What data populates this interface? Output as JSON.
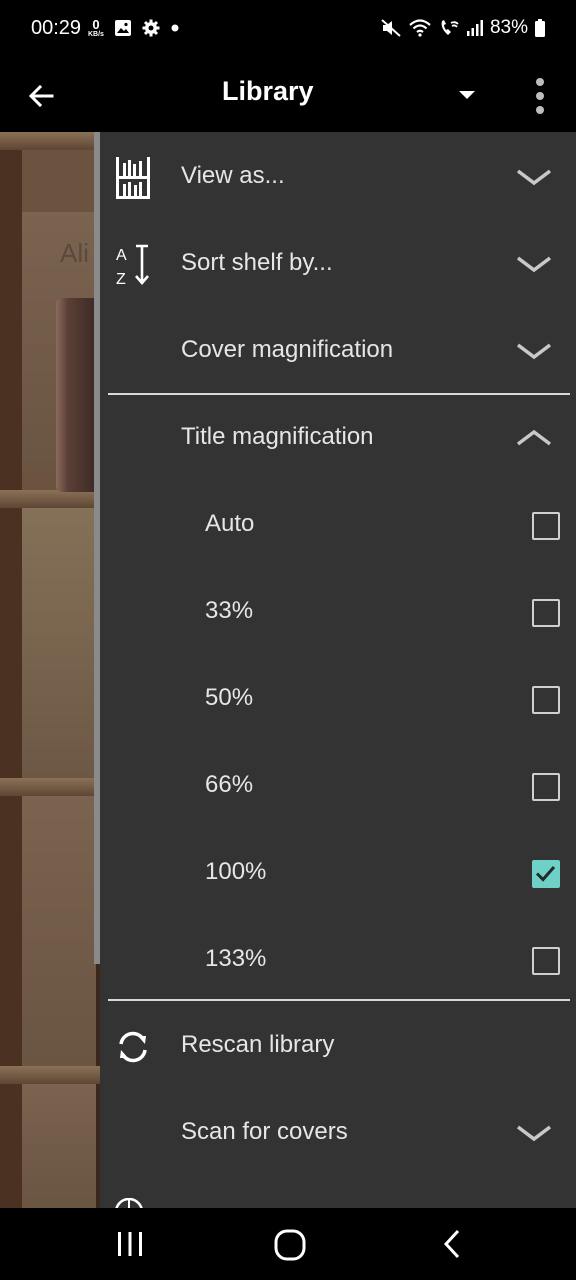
{
  "status_bar": {
    "time": "00:29",
    "net_speed_value": "0",
    "net_speed_unit": "KB/s",
    "battery": "83%",
    "icons": [
      "gallery-icon",
      "settings-gear-icon",
      "notification-dot-icon",
      "mute-icon",
      "wifi-icon",
      "wifi-calling-icon",
      "signal-icon",
      "battery-icon"
    ]
  },
  "app_bar": {
    "title": "Library",
    "icons": [
      "back-arrow-icon",
      "dropdown-arrow-icon",
      "overflow-menu-icon"
    ]
  },
  "shelf": {
    "partial_title": "Ali"
  },
  "menu": {
    "view_as": "View as...",
    "sort_shelf": "Sort shelf by...",
    "cover_magnification": "Cover magnification",
    "title_magnification": "Title magnification",
    "options": [
      {
        "label": "Auto",
        "checked": false
      },
      {
        "label": "33%",
        "checked": false
      },
      {
        "label": "50%",
        "checked": false
      },
      {
        "label": "66%",
        "checked": false
      },
      {
        "label": "100%",
        "checked": true
      },
      {
        "label": "133%",
        "checked": false
      }
    ],
    "rescan_library": "Rescan library",
    "scan_for_covers": "Scan for covers"
  },
  "colors": {
    "drawer_bg": "#333333",
    "checkbox_checked": "#6fd0c8",
    "text": "#e6e6e6"
  }
}
